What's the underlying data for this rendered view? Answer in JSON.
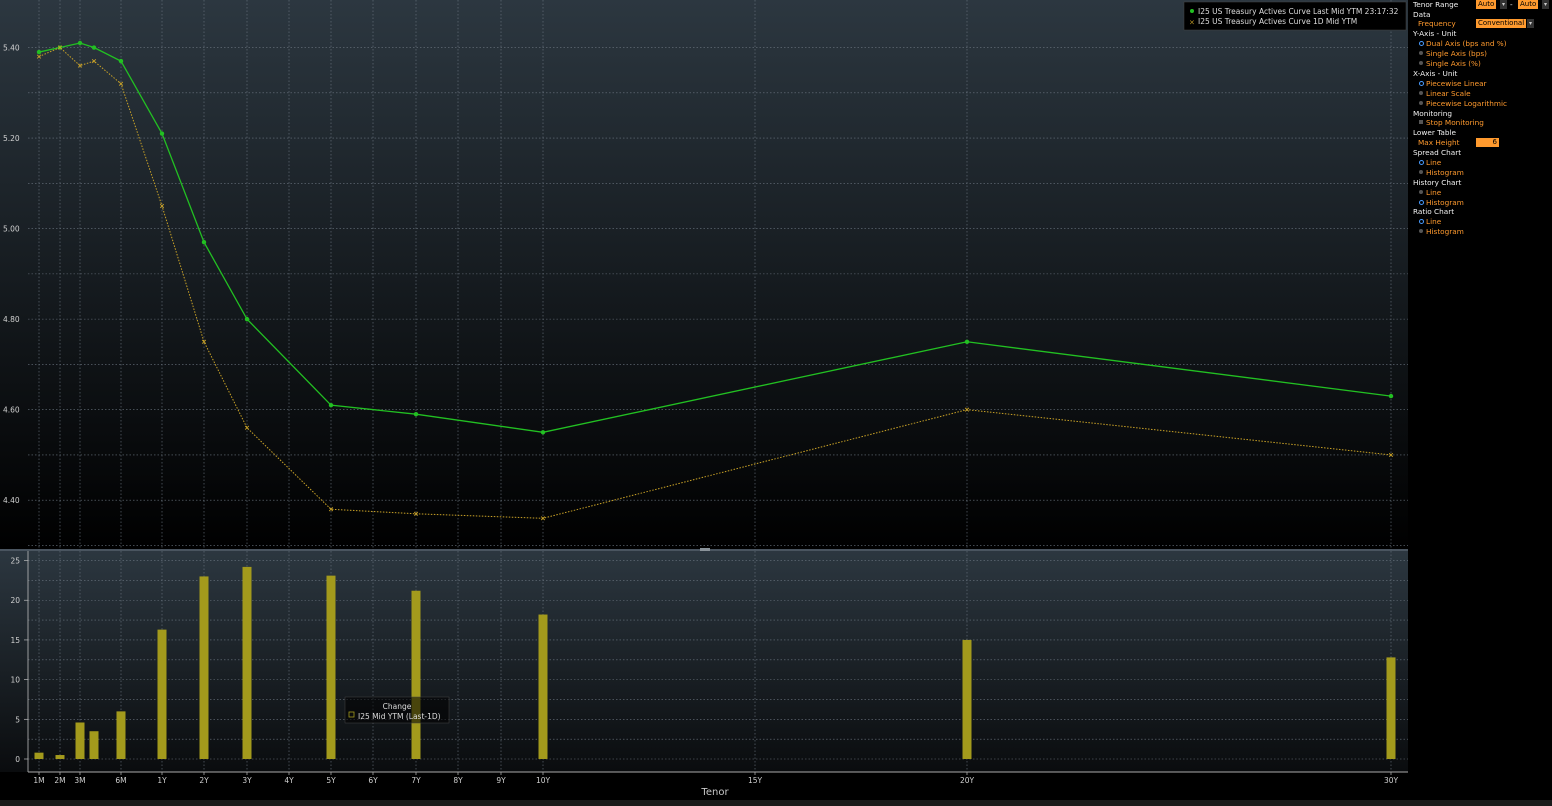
{
  "chart_data": [
    {
      "type": "line",
      "x_categories": [
        "1M",
        "2M",
        "3M",
        "4M",
        "6M",
        "1Y",
        "2Y",
        "3Y",
        "5Y",
        "7Y",
        "10Y",
        "20Y",
        "30Y"
      ],
      "series": [
        {
          "name": "I25 US Treasury Actives Curve Last Mid YTM 23:17:32",
          "color": "#22c022",
          "marker": "dot",
          "values": [
            5.39,
            5.4,
            5.41,
            5.4,
            5.37,
            5.21,
            4.97,
            4.8,
            4.61,
            4.59,
            4.55,
            4.75,
            4.63
          ]
        },
        {
          "name": "I25 US Treasury Actives Curve 1D Mid YTM",
          "color": "#c9a227",
          "marker": "x",
          "dashed": true,
          "values": [
            5.38,
            5.4,
            5.36,
            5.37,
            5.32,
            5.05,
            4.75,
            4.56,
            4.38,
            4.37,
            4.36,
            4.6,
            4.5
          ]
        }
      ],
      "y_ticks": [
        "4.40",
        "4.60",
        "4.80",
        "5.00",
        "5.20",
        "5.40"
      ],
      "ylim": [
        4.29,
        5.505
      ],
      "grid": true,
      "legend": "top-right"
    },
    {
      "type": "bar",
      "title": "Change",
      "series": [
        {
          "name": "I25 Mid YTM (Last-1D)",
          "color": "#a39a1c",
          "x": [
            "1M",
            "2M",
            "3M",
            "4M",
            "6M",
            "1Y",
            "2Y",
            "3Y",
            "5Y",
            "7Y",
            "10Y",
            "20Y",
            "30Y"
          ],
          "values": [
            0.8,
            0.5,
            4.6,
            3.5,
            6.0,
            16.3,
            23.0,
            24.2,
            23.1,
            21.2,
            18.2,
            15.0,
            12.8
          ]
        }
      ],
      "y_ticks": [
        "0",
        "5",
        "10",
        "15",
        "20",
        "25"
      ],
      "ylim": [
        0,
        25.7
      ],
      "x_ticks": [
        "1M",
        "2M",
        "3M",
        "6M",
        "1Y",
        "2Y",
        "3Y",
        "4Y",
        "5Y",
        "6Y",
        "7Y",
        "8Y",
        "9Y",
        "10Y",
        "15Y",
        "20Y",
        "30Y"
      ],
      "xlabel": "Tenor",
      "grid": true
    }
  ],
  "panel": {
    "tenor_range_label": "Tenor Range",
    "tenor_from": "Auto",
    "tenor_sep": "-",
    "tenor_to": "Auto",
    "data_label": "Data",
    "frequency_label": "Frequency",
    "frequency_value": "Conventional",
    "yaxis_label": "Y-Axis - Unit",
    "yaxis_opts": [
      "Dual Axis (bps and %)",
      "Single Axis (bps)",
      "Single Axis (%)"
    ],
    "xaxis_label": "X-Axis - Unit",
    "xaxis_opts": [
      "Piecewise Linear",
      "Linear Scale",
      "Piecewise Logarithmic"
    ],
    "monitoring_label": "Monitoring",
    "monitoring_opt": "Stop Monitoring",
    "lower_table_label": "Lower Table",
    "max_height_label": "Max Height",
    "max_height_value": "6",
    "spread_label": "Spread Chart",
    "spread_opts": [
      "Line",
      "Histogram"
    ],
    "history_label": "History Chart",
    "history_opts": [
      "Line",
      "Histogram"
    ],
    "ratio_label": "Ratio Chart",
    "ratio_opts": [
      "Line",
      "Histogram"
    ]
  }
}
